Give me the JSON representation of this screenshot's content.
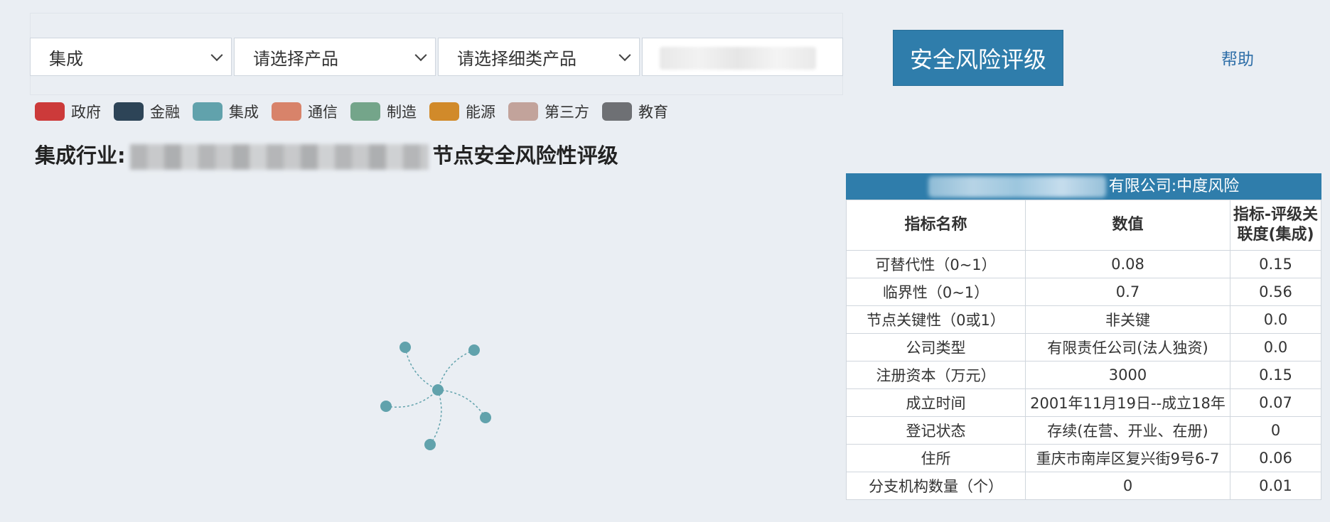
{
  "filters": {
    "industry": "集成",
    "product": "请选择产品",
    "sub_product": "请选择细类产品",
    "company_input_value": ""
  },
  "rate_button": "安全风险评级",
  "help_link": "帮助",
  "legend": [
    {
      "label": "政府",
      "color": "#cc3a3a"
    },
    {
      "label": "金融",
      "color": "#2d4457"
    },
    {
      "label": "集成",
      "color": "#61a2ac"
    },
    {
      "label": "通信",
      "color": "#d8836a"
    },
    {
      "label": "制造",
      "color": "#74a58a"
    },
    {
      "label": "能源",
      "color": "#d18a2a"
    },
    {
      "label": "第三方",
      "color": "#c2a39b"
    },
    {
      "label": "教育",
      "color": "#6e7074"
    }
  ],
  "graph_title": {
    "prefix": "集成行业:",
    "suffix": "节点安全风险性评级"
  },
  "graph": {
    "node_color": "#61a2ac"
  },
  "table": {
    "caption_suffix": "有限公司:中度风险",
    "headers": [
      "指标名称",
      "数值",
      "指标-评级关联度(集成)"
    ],
    "rows": [
      [
        "可替代性（0~1）",
        "0.08",
        "0.15"
      ],
      [
        "临界性（0~1）",
        "0.7",
        "0.56"
      ],
      [
        "节点关键性（0或1）",
        "非关键",
        "0.0"
      ],
      [
        "公司类型",
        "有限责任公司(法人独资)",
        "0.0"
      ],
      [
        "注册资本（万元）",
        "3000",
        "0.15"
      ],
      [
        "成立时间",
        "2001年11月19日--成立18年",
        "0.07"
      ],
      [
        "登记状态",
        "存续(在营、开业、在册)",
        "0"
      ],
      [
        "住所",
        "重庆市南岸区复兴街9号6-7",
        "0.06"
      ],
      [
        "分支机构数量（个）",
        "0",
        "0.01"
      ]
    ]
  }
}
